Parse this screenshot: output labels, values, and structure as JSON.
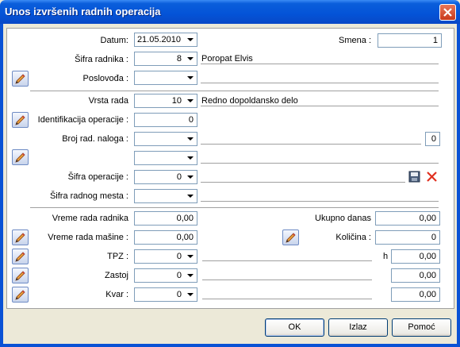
{
  "window": {
    "title": "Unos izvršenih radnih operacija"
  },
  "form": {
    "datum_label": "Datum:",
    "datum_value": "21.05.2010",
    "smena_label": "Smena :",
    "smena_value": "1",
    "sifra_radnika_label": "Šifra radnika :",
    "sifra_radnika_value": "8",
    "sifra_radnika_name": "Poropat Elvis",
    "poslovodja_label": "Poslovođa :",
    "poslovodja_value": "",
    "vrsta_rada_label": "Vrsta rada",
    "vrsta_rada_value": "10",
    "vrsta_rada_name": "Redno dopoldansko delo",
    "ident_label": "Identifikacija operacije :",
    "ident_value": "0",
    "broj_naloga_label": "Broj rad. naloga :",
    "broj_naloga_value": "",
    "broj_naloga_count": "0",
    "extra_combo_value": "",
    "sifra_operacije_label": "Šifra operacije :",
    "sifra_operacije_value": "0",
    "sifra_mesta_label": "Šifra radnog mesta :",
    "sifra_mesta_value": "",
    "vreme_radnika_label": "Vreme rada radnika",
    "vreme_radnika_value": "0,00",
    "ukupno_label": "Ukupno danas",
    "ukupno_value": "0,00",
    "vreme_masine_label": "Vreme rada mašine :",
    "vreme_masine_value": "0,00",
    "kolicina_label": "Količina :",
    "kolicina_value": "0",
    "tpz_label": "TPZ :",
    "tpz_value": "0",
    "h_label": "h",
    "tpz_hours": "0,00",
    "zastoj_label": "Zastoj",
    "zastoj_value": "0",
    "zastoj_hours": "0,00",
    "kvar_label": "Kvar :",
    "kvar_value": "0",
    "kvar_hours": "0,00"
  },
  "buttons": {
    "ok": "OK",
    "izlaz": "Izlaz",
    "pomoc": "Pomoć"
  },
  "icons": {
    "edit": "pencil-icon",
    "save": "floppy-disk-icon",
    "delete": "red-x-icon",
    "close": "close-icon",
    "dropdown": "chevron-down-icon"
  }
}
